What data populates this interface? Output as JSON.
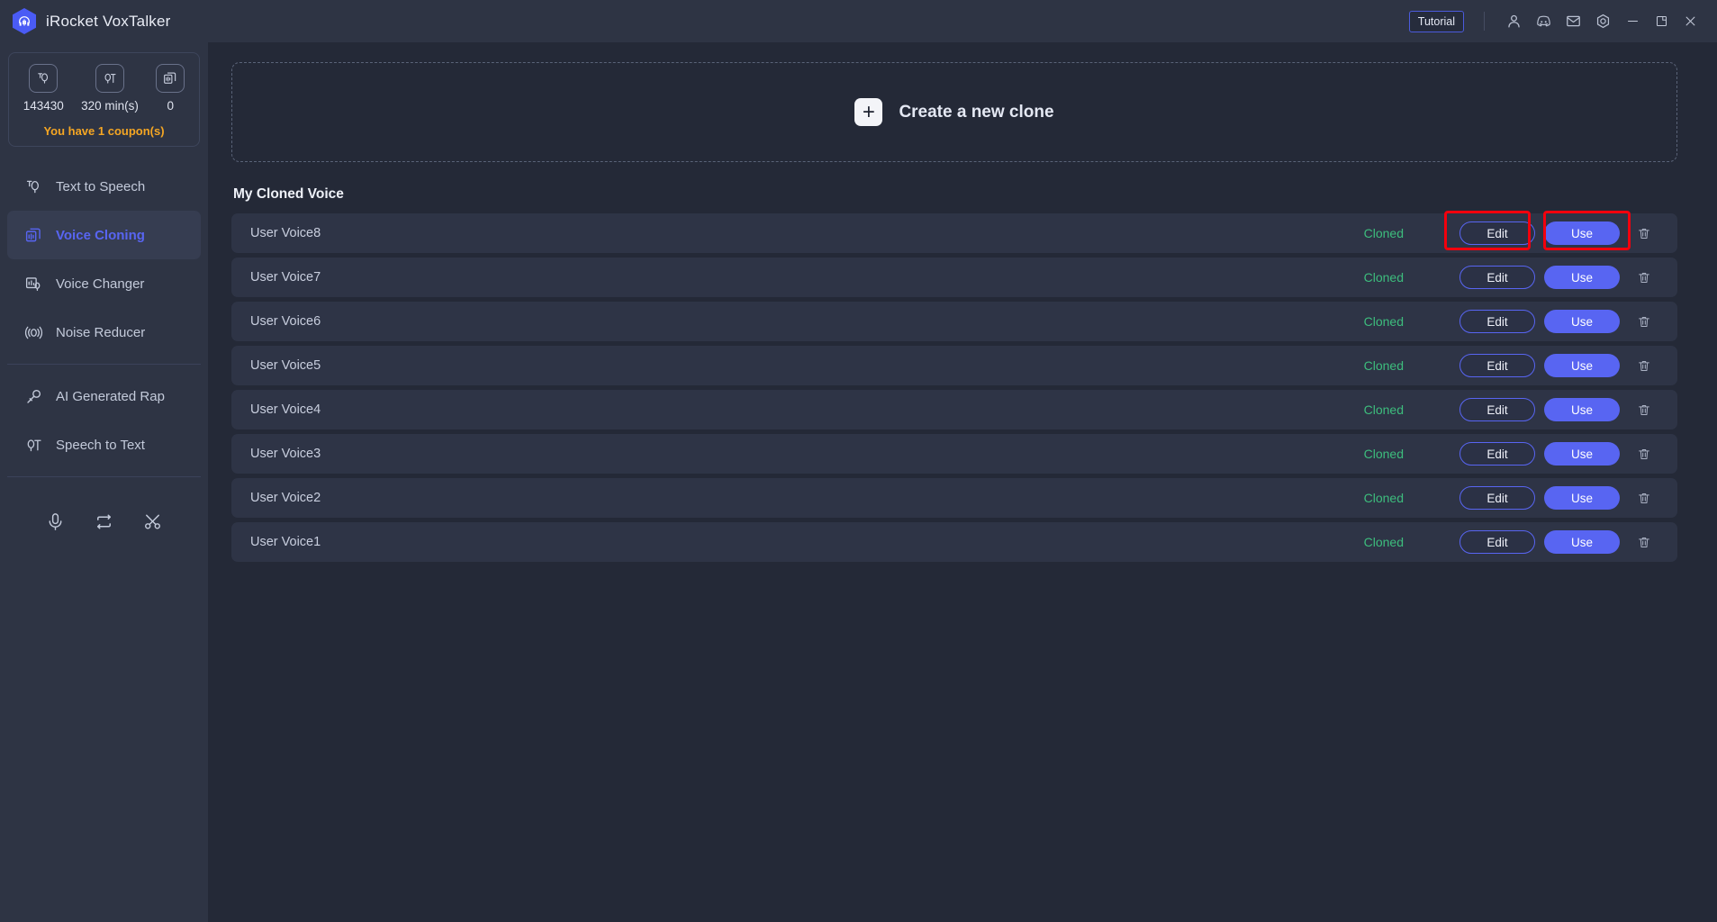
{
  "titlebar": {
    "app_title": "iRocket VoxTalker",
    "logo_icon": "headphones-hexagon-logo",
    "tutorial_label": "Tutorial",
    "icons": [
      {
        "name": "account-icon",
        "glyph": "user"
      },
      {
        "name": "discord-icon",
        "glyph": "discord"
      },
      {
        "name": "mail-icon",
        "glyph": "envelope"
      },
      {
        "name": "settings-icon",
        "glyph": "gear"
      }
    ],
    "window_controls": [
      {
        "name": "minimize-button",
        "glyph": "minimize"
      },
      {
        "name": "maximize-button",
        "glyph": "maximize"
      },
      {
        "name": "close-button",
        "glyph": "close"
      }
    ]
  },
  "sidebar": {
    "stats": [
      {
        "icon": "text-to-speech-icon",
        "value": "143430"
      },
      {
        "icon": "speech-to-text-icon",
        "value": "320 min(s)"
      },
      {
        "icon": "voice-clone-icon",
        "value": "0"
      }
    ],
    "coupon_text": "You have 1 coupon(s)",
    "items": [
      {
        "label": "Text to Speech",
        "icon": "text-to-speech-icon",
        "active": false
      },
      {
        "label": "Voice Cloning",
        "icon": "voice-cloning-icon",
        "active": true
      },
      {
        "label": "Voice Changer",
        "icon": "voice-changer-icon",
        "active": false
      },
      {
        "label": "Noise Reducer",
        "icon": "noise-reducer-icon",
        "active": false
      },
      {
        "label": "AI Generated Rap",
        "icon": "ai-rap-icon",
        "active": false
      },
      {
        "label": "Speech to Text",
        "icon": "speech-to-text-icon",
        "active": false
      }
    ],
    "tools": [
      {
        "name": "recorder-icon",
        "glyph": "microphone"
      },
      {
        "name": "converter-icon",
        "glyph": "loop"
      },
      {
        "name": "cutter-icon",
        "glyph": "scissors"
      }
    ]
  },
  "main": {
    "create_clone_label": "Create a new clone",
    "create_clone_plus": "+",
    "section_title": "My Cloned Voice",
    "status_label": "Cloned",
    "edit_label": "Edit",
    "use_label": "Use",
    "delete_icon": "trash-icon",
    "voices": [
      {
        "name": "User Voice8",
        "status": "Cloned",
        "highlighted": true
      },
      {
        "name": "User Voice7",
        "status": "Cloned",
        "highlighted": false
      },
      {
        "name": "User Voice6",
        "status": "Cloned",
        "highlighted": false
      },
      {
        "name": "User Voice5",
        "status": "Cloned",
        "highlighted": false
      },
      {
        "name": "User Voice4",
        "status": "Cloned",
        "highlighted": false
      },
      {
        "name": "User Voice3",
        "status": "Cloned",
        "highlighted": false
      },
      {
        "name": "User Voice2",
        "status": "Cloned",
        "highlighted": false
      },
      {
        "name": "User Voice1",
        "status": "Cloned",
        "highlighted": false
      }
    ]
  },
  "colors": {
    "app_background": "#242937",
    "sidebar_background": "#2e3444",
    "titlebar_background": "#2e3444",
    "row_background": "#2e3446",
    "accent": "#5865f2",
    "status_green": "#3dbd7d",
    "coupon_orange": "#f5a623",
    "highlight_red": "#f3000d"
  }
}
